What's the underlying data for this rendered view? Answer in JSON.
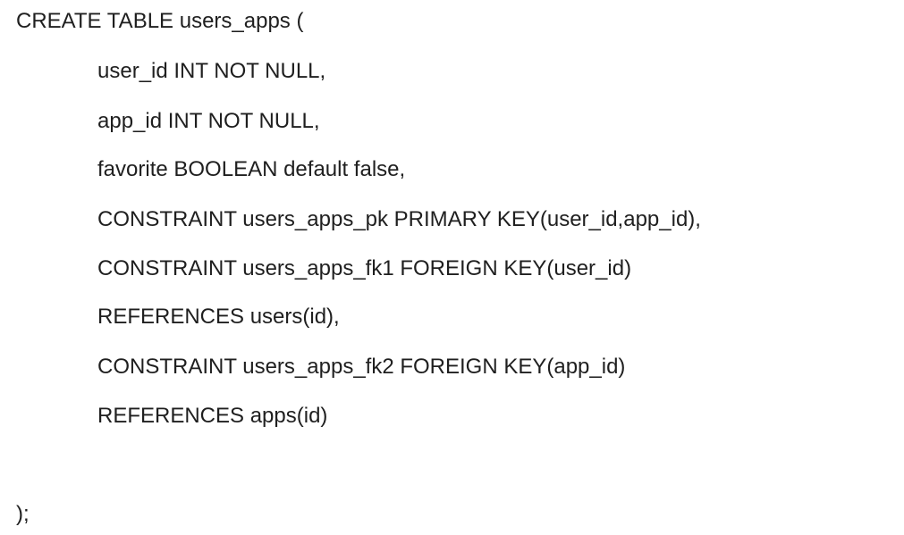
{
  "document": {
    "lines": [
      "CREATE TABLE users_apps (",
      "user_id INT NOT NULL,",
      "app_id INT NOT NULL,",
      "favorite BOOLEAN default false,",
      "CONSTRAINT users_apps_pk PRIMARY KEY(user_id,app_id),",
      "CONSTRAINT users_apps_fk1 FOREIGN KEY(user_id)",
      "REFERENCES users(id),",
      "CONSTRAINT users_apps_fk2 FOREIGN KEY(app_id)",
      "REFERENCES apps(id)",
      ");"
    ]
  },
  "colors": {
    "background": "#ffffff",
    "text": "#1f1f1f"
  }
}
